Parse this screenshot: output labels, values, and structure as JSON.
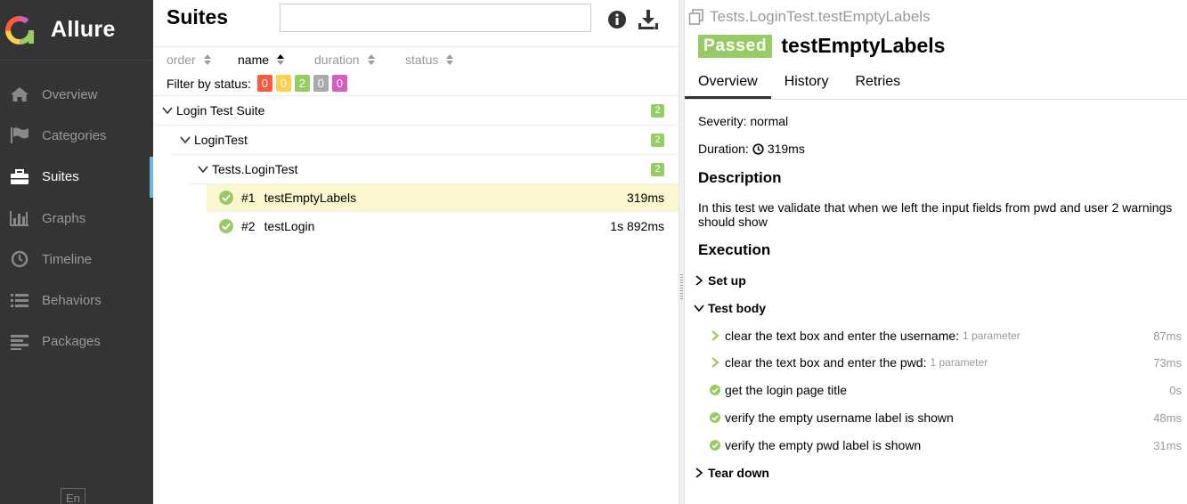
{
  "brand": {
    "name": "Allure"
  },
  "sidebar": {
    "items": [
      {
        "label": "Overview",
        "icon": "home-icon",
        "active": false
      },
      {
        "label": "Categories",
        "icon": "flag-icon",
        "active": false
      },
      {
        "label": "Suites",
        "icon": "briefcase-icon",
        "active": true
      },
      {
        "label": "Graphs",
        "icon": "bar-chart-icon",
        "active": false
      },
      {
        "label": "Timeline",
        "icon": "clock-icon",
        "active": false
      },
      {
        "label": "Behaviors",
        "icon": "list-icon",
        "active": false
      },
      {
        "label": "Packages",
        "icon": "align-left-icon",
        "active": false
      }
    ],
    "language": "En"
  },
  "suites": {
    "title": "Suites",
    "search_value": "",
    "sort": {
      "order": "order",
      "name": "name",
      "duration": "duration",
      "status": "status"
    },
    "filter_label": "Filter by status:",
    "filter_counts": {
      "failed": "0",
      "broken": "0",
      "passed": "2",
      "skipped": "0",
      "unknown": "0"
    },
    "tree": {
      "suite": {
        "name": "Login Test Suite",
        "count": "2"
      },
      "class": {
        "name": "LoginTest",
        "count": "2"
      },
      "package": {
        "name": "Tests.LoginTest",
        "count": "2"
      },
      "tests": [
        {
          "num": "#1",
          "name": "testEmptyLabels",
          "duration": "319ms",
          "selected": true
        },
        {
          "num": "#2",
          "name": "testLogin",
          "duration": "1s 892ms",
          "selected": false
        }
      ]
    }
  },
  "detail": {
    "breadcrumb": "Tests.LoginTest.testEmptyLabels",
    "status": "Passed",
    "title": "testEmptyLabels",
    "tabs": [
      "Overview",
      "History",
      "Retries"
    ],
    "severity": "Severity: normal",
    "duration_label": "Duration:",
    "duration_value": "319ms",
    "description_title": "Description",
    "description_text": "In this test we validate that when we left the input fields from pwd and user 2 warnings should show",
    "execution_title": "Execution",
    "setup_label": "Set up",
    "body_label": "Test body",
    "teardown_label": "Tear down",
    "steps": [
      {
        "text": "clear the text box and enter the username:",
        "param": "1 parameter",
        "duration": "87ms",
        "icon": "chevron-right-icon"
      },
      {
        "text": "clear the text box and enter the pwd:",
        "param": "1 parameter",
        "duration": "73ms",
        "icon": "chevron-right-icon"
      },
      {
        "text": "get the login page title",
        "param": "",
        "duration": "0s",
        "icon": "check-circle-icon"
      },
      {
        "text": "verify the empty username label is shown",
        "param": "",
        "duration": "48ms",
        "icon": "check-circle-icon"
      },
      {
        "text": "verify the empty pwd label is shown",
        "param": "",
        "duration": "31ms",
        "icon": "check-circle-icon"
      }
    ]
  },
  "colors": {
    "sidebar_bg": "#343434",
    "accent": "#6eb4e1",
    "passed": "#97cc64",
    "failed": "#fd5a3e",
    "broken": "#ffd050",
    "skipped": "#aaaaaa",
    "unknown": "#d35ebe",
    "selected_row": "#fcf6ce"
  }
}
